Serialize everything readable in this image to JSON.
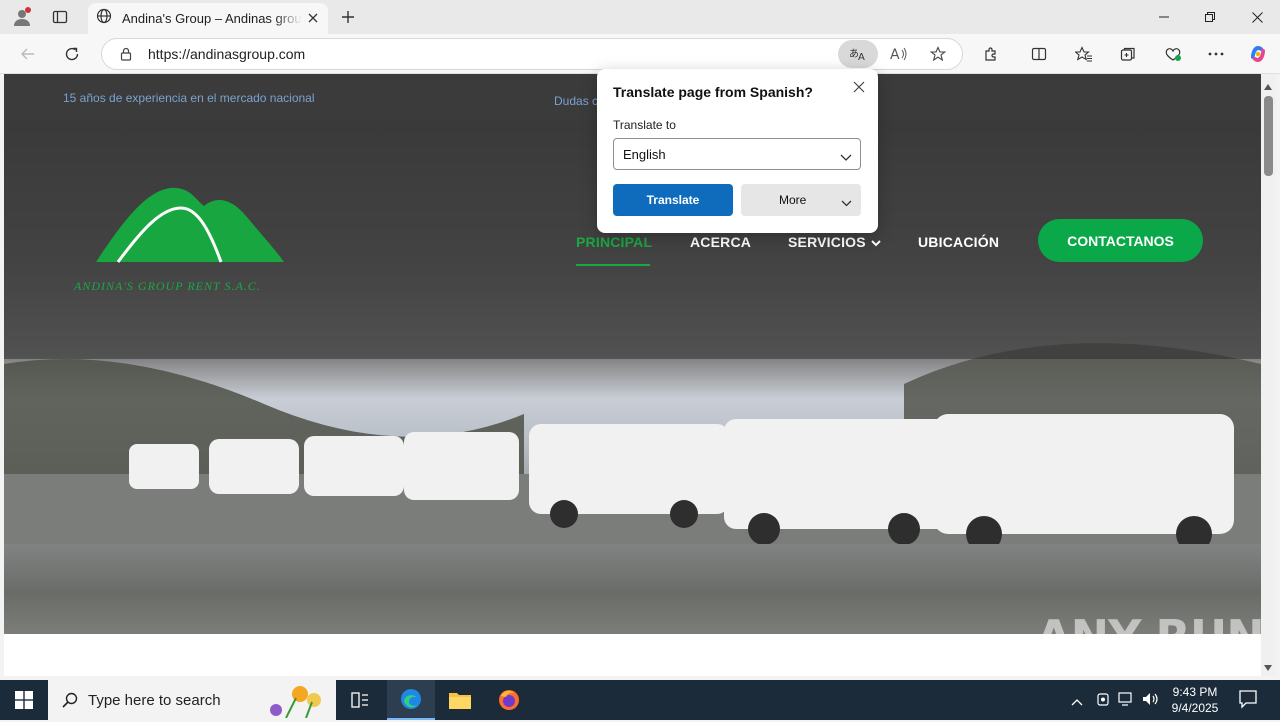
{
  "browser": {
    "tab_title": "Andina's Group – Andinas group.",
    "url": "https://andinasgroup.com"
  },
  "page": {
    "topbar_left": "15 años de experiencia en el mercado nacional",
    "topbar_mid": "Dudas c",
    "logo_text": "ANDINA'S GROUP RENT S.A.C.",
    "nav": {
      "principal": "PRINCIPAL",
      "acerca": "ACERCA",
      "servicios": "SERVICIOS",
      "ubicacion": "UBICACIÓN"
    },
    "cta": "CONTACTANOS",
    "colors": {
      "brand_green": "#0ba84a",
      "topbar": "#3b3b3b"
    }
  },
  "translate_popup": {
    "title": "Translate page from Spanish?",
    "label": "Translate to",
    "selected_language": "English",
    "translate_button": "Translate",
    "more_button": "More"
  },
  "watermark": "ANY RUN",
  "taskbar": {
    "search_placeholder": "Type here to search",
    "time": "9:43 PM",
    "date": "9/4/2025"
  }
}
